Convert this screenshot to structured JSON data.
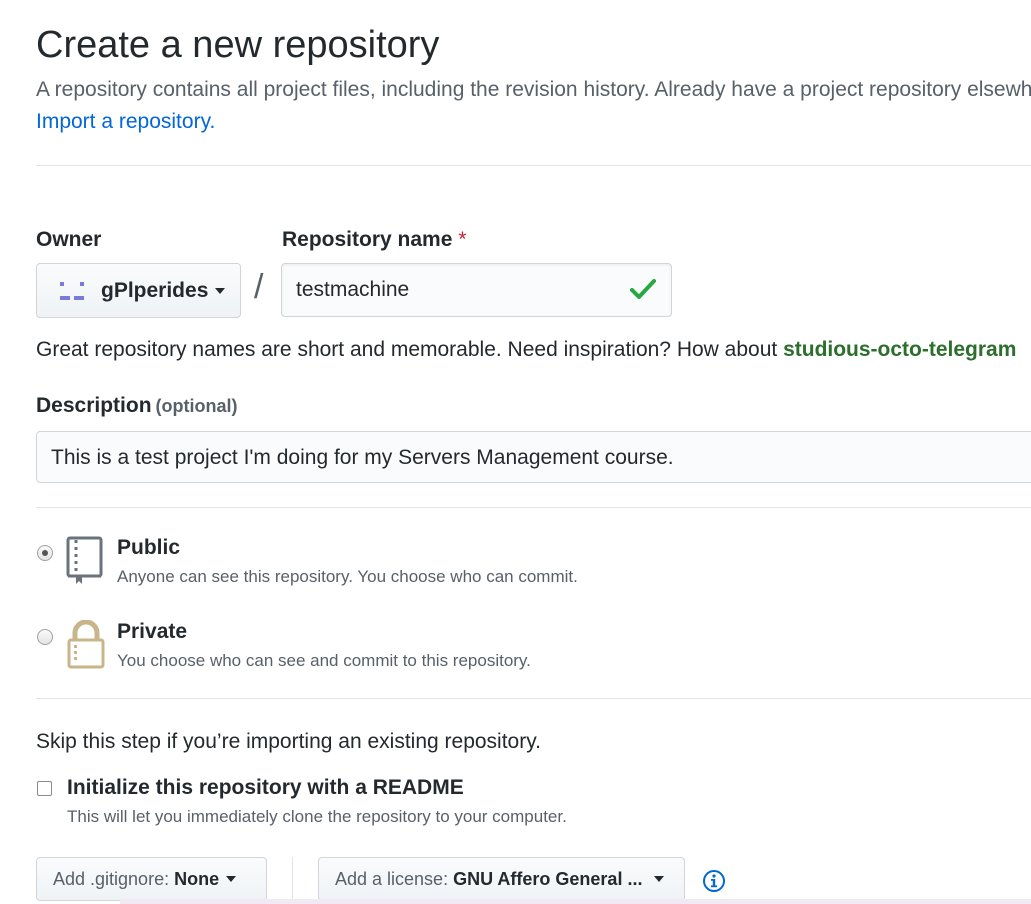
{
  "header": {
    "title": "Create a new repository",
    "subtitle": "A repository contains all project files, including the revision history. Already have a project repository elsewhere?",
    "import_link": "Import a repository."
  },
  "owner": {
    "label": "Owner",
    "value": "gPlperides"
  },
  "repo_name": {
    "label": "Repository name",
    "required_mark": "*",
    "value": "testmachine",
    "separator": "/"
  },
  "name_hint": {
    "text": "Great repository names are short and memorable. Need inspiration? How about ",
    "suggestion": "studious-octo-telegram"
  },
  "description": {
    "label": "Description",
    "optional_text": "(optional)",
    "value": "This is a test project I'm doing for my Servers Management course."
  },
  "visibility": {
    "selected": "public",
    "public": {
      "title": "Public",
      "desc": "Anyone can see this repository. You choose who can commit."
    },
    "private": {
      "title": "Private",
      "desc": "You choose who can see and commit to this repository."
    }
  },
  "init": {
    "skip_text": "Skip this step if you’re importing an existing repository.",
    "checkbox_label": "Initialize this repository with a README",
    "checkbox_desc": "This will let you immediately clone the repository to your computer.",
    "checked": false
  },
  "gitignore": {
    "prefix": "Add .gitignore:",
    "value": "None"
  },
  "license": {
    "prefix": "Add a license:",
    "value": "GNU Affero General ..."
  },
  "colors": {
    "link": "#0366d6",
    "success": "#28a745",
    "required": "#cb2431",
    "avatar": "#7a7bd7",
    "icon_brown": "#c8b68a"
  }
}
